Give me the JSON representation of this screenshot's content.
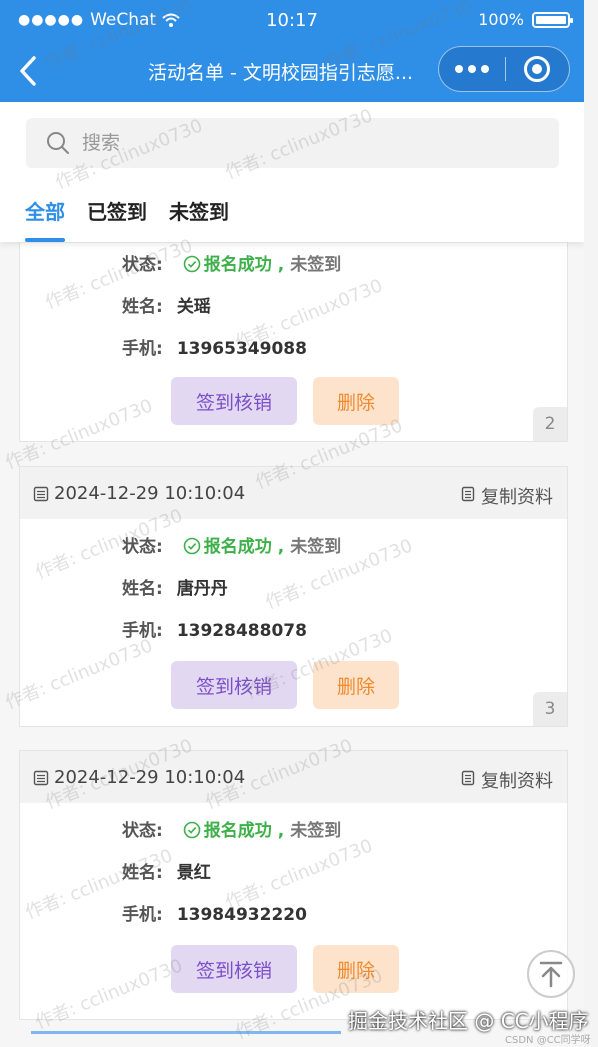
{
  "status_bar": {
    "carrier": "WeChat",
    "time": "10:17",
    "battery": "100%",
    "battery_level": 1.0
  },
  "nav": {
    "title": "活动名单 - 文明校园指引志愿..."
  },
  "search": {
    "placeholder": "搜索",
    "value": ""
  },
  "tabs": [
    {
      "label": "全部",
      "active": true
    },
    {
      "label": "已签到",
      "active": false
    },
    {
      "label": "未签到",
      "active": false
    }
  ],
  "labels": {
    "status": "状态:",
    "name": "姓名:",
    "phone": "手机:",
    "copy": "复制资料",
    "checkin": "签到核销",
    "delete": "删除",
    "status_ok": "报名成功",
    "status_sep": ",",
    "status_not": "未签到"
  },
  "cards": [
    {
      "date": "",
      "name": "关瑶",
      "phone": "13965349088",
      "index": "2"
    },
    {
      "date": "2024-12-29 10:10:04",
      "name": "唐丹丹",
      "phone": "13928488078",
      "index": "3"
    },
    {
      "date": "2024-12-29 10:10:04",
      "name": "景红",
      "phone": "13984932220",
      "index": ""
    }
  ],
  "watermark": "作者: cclinux0730",
  "footer": {
    "caption": "掘金技术社区 @ CC小程序",
    "csdn": "CSDN @CC同学呀"
  },
  "colors": {
    "primary": "#2f8fe6",
    "success": "#3db04a",
    "checkin_bg": "#e2d8f2",
    "checkin_text": "#7b4fc8",
    "delete_bg": "#fde3cc",
    "delete_text": "#f08a2c"
  }
}
